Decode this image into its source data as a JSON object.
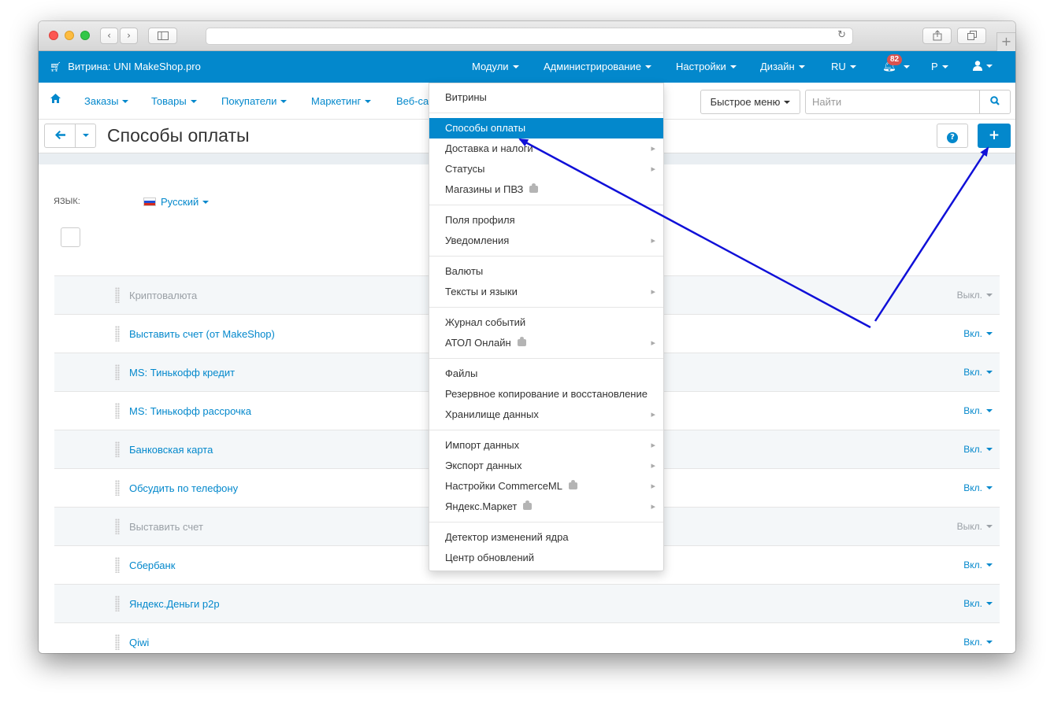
{
  "browser": {
    "back_glyph": "‹",
    "forward_glyph": "›",
    "new_tab_glyph": "+"
  },
  "topbar": {
    "store_label": "Витрина: UNI MakeShop.pro",
    "menu": [
      "Модули",
      "Администрирование",
      "Настройки",
      "Дизайн",
      "RU"
    ],
    "notifications_count": "82",
    "currency": "Р",
    "color": "#0388cc"
  },
  "subnav": {
    "items": [
      "Заказы",
      "Товары",
      "Покупатели",
      "Маркетинг",
      "Веб-са"
    ],
    "quick_menu": "Быстрое меню",
    "search_placeholder": "Найти"
  },
  "page": {
    "title": "Способы оплаты",
    "language_label": "ЯЗЫК:",
    "language_value": "Русский"
  },
  "payments": [
    {
      "name": "Криптовалюта",
      "status": "Выкл.",
      "enabled": false
    },
    {
      "name": "Выставить счет (от MakeShop)",
      "status": "Вкл.",
      "enabled": true
    },
    {
      "name": "MS: Тинькофф кредит",
      "status": "Вкл.",
      "enabled": true
    },
    {
      "name": "MS: Тинькофф рассрочка",
      "status": "Вкл.",
      "enabled": true
    },
    {
      "name": "Банковская карта",
      "status": "Вкл.",
      "enabled": true
    },
    {
      "name": "Обсудить по телефону",
      "status": "Вкл.",
      "enabled": true
    },
    {
      "name": "Выставить счет",
      "status": "Выкл.",
      "enabled": false
    },
    {
      "name": "Сбербанк",
      "status": "Вкл.",
      "enabled": true
    },
    {
      "name": "Яндекс.Деньги p2p",
      "status": "Вкл.",
      "enabled": true
    },
    {
      "name": "Qiwi",
      "status": "Вкл.",
      "enabled": true
    }
  ],
  "admin_menu": [
    {
      "label": "Витрины",
      "submenu": false,
      "addon": false,
      "active": false
    },
    {
      "label": "Способы оплаты",
      "submenu": false,
      "addon": false,
      "active": true
    },
    {
      "label": "Доставка и налоги",
      "submenu": true,
      "addon": false,
      "active": false
    },
    {
      "label": "Статусы",
      "submenu": true,
      "addon": false,
      "active": false
    },
    {
      "label": "Магазины и ПВЗ",
      "submenu": false,
      "addon": true,
      "active": false
    },
    {
      "label": "Поля профиля",
      "submenu": false,
      "addon": false,
      "active": false
    },
    {
      "label": "Уведомления",
      "submenu": true,
      "addon": false,
      "active": false
    },
    {
      "label": "Валюты",
      "submenu": false,
      "addon": false,
      "active": false
    },
    {
      "label": "Тексты и языки",
      "submenu": true,
      "addon": false,
      "active": false
    },
    {
      "label": "Журнал событий",
      "submenu": false,
      "addon": false,
      "active": false
    },
    {
      "label": "АТОЛ Онлайн",
      "submenu": true,
      "addon": true,
      "active": false
    },
    {
      "label": "Файлы",
      "submenu": false,
      "addon": false,
      "active": false
    },
    {
      "label": "Резервное копирование и восстановление",
      "submenu": false,
      "addon": false,
      "active": false
    },
    {
      "label": "Хранилище данных",
      "submenu": true,
      "addon": false,
      "active": false
    },
    {
      "label": "Импорт данных",
      "submenu": true,
      "addon": false,
      "active": false
    },
    {
      "label": "Экспорт данных",
      "submenu": true,
      "addon": false,
      "active": false
    },
    {
      "label": "Настройки CommerceML",
      "submenu": true,
      "addon": true,
      "active": false
    },
    {
      "label": "Яндекс.Маркет",
      "submenu": true,
      "addon": true,
      "active": false
    },
    {
      "label": "Детектор изменений ядра",
      "submenu": false,
      "addon": false,
      "active": false
    },
    {
      "label": "Центр обновлений",
      "submenu": false,
      "addon": false,
      "active": false
    }
  ],
  "annotation": {
    "arrow_color": "#1010d8"
  }
}
